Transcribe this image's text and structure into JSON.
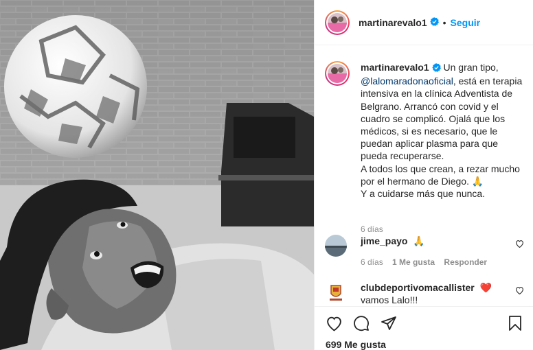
{
  "post": {
    "username": "martinarevalo1",
    "follow_label": "Seguir",
    "separator": "•"
  },
  "caption": {
    "username": "martinarevalo1",
    "text_1": " Un gran tipo, ",
    "mention": "@lalomaradonaoficial",
    "text_2": ", está en terapia intensiva en la clínica Adventista de Belgrano. Arrancó con covid y el cuadro se complicó. Ojalá que los médicos, si es necesario, que le puedan aplicar plasma para que pueda recuperarse.",
    "text_3": "A todos los que crean, a rezar mucho por el hermano de Diego. 🙏",
    "text_4": "Y a cuidarse más que nunca.",
    "time": "6 días"
  },
  "comments": [
    {
      "user": "jime_payo",
      "text": "🙏",
      "time": "6 días",
      "likes": "1 Me gusta",
      "reply": "Responder"
    },
    {
      "user": "clubdeportivomacallister",
      "text": "❤️",
      "text2": "vamos Lalo!!!"
    }
  ],
  "footer": {
    "likes": "699 Me gusta"
  },
  "icons": [
    "verified-badge-icon",
    "heart-icon",
    "comment-icon",
    "share-icon",
    "bookmark-icon"
  ],
  "colors": {
    "accent": "#0095f6",
    "verified": "#0095f6",
    "text": "#262626",
    "muted": "#8e8e8e",
    "heart": "#ed4956"
  }
}
